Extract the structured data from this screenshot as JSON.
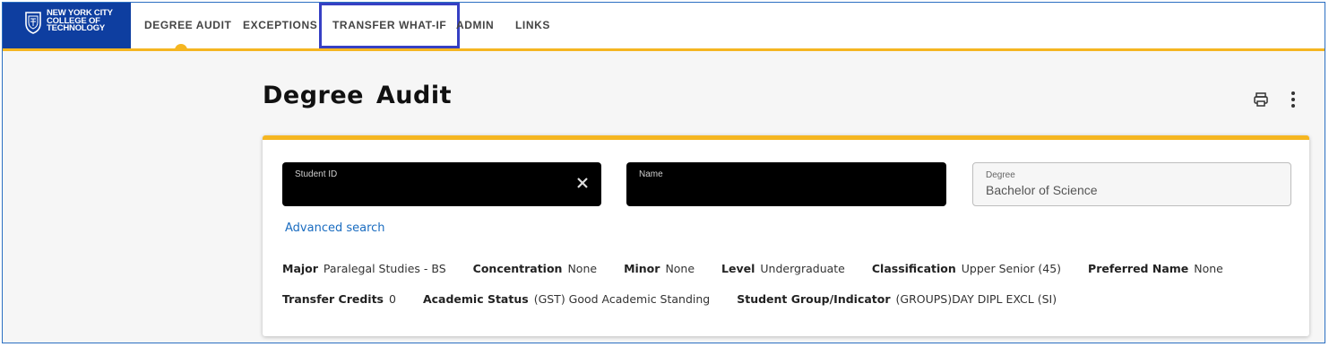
{
  "header": {
    "logo_lines": [
      "New York City",
      "College of",
      "Technology"
    ],
    "nav": [
      {
        "label": "DEGREE AUDIT",
        "active": true
      },
      {
        "label": "EXCEPTIONS"
      },
      {
        "label": "TRANSFER WHAT-IF",
        "highlighted": true
      },
      {
        "label": "ADMIN"
      },
      {
        "label": "LINKS"
      }
    ],
    "brand_color": "#0e3ea0",
    "accent_color": "#f5b621"
  },
  "page": {
    "title": "Degree Audit",
    "icons": [
      "print-icon",
      "more-vertical-icon"
    ]
  },
  "student": {
    "id_label": "Student ID",
    "name_label": "Name",
    "degree_label": "Degree",
    "degree_value": "Bachelor of Science",
    "advanced_search": "Advanced search"
  },
  "info": {
    "row1": [
      {
        "key": "Major",
        "value": "Paralegal Studies - BS"
      },
      {
        "key": "Concentration",
        "value": "None"
      },
      {
        "key": "Minor",
        "value": "None"
      },
      {
        "key": "Level",
        "value": "Undergraduate"
      },
      {
        "key": "Classification",
        "value": "Upper Senior (45)"
      },
      {
        "key": "Preferred Name",
        "value": "None"
      }
    ],
    "row2": [
      {
        "key": "Transfer Credits",
        "value": "0"
      },
      {
        "key": "Academic Status",
        "value": "(GST) Good Academic Standing"
      },
      {
        "key": "Student Group/Indicator",
        "value": "(GROUPS)DAY DIPL EXCL (SI)"
      }
    ]
  }
}
